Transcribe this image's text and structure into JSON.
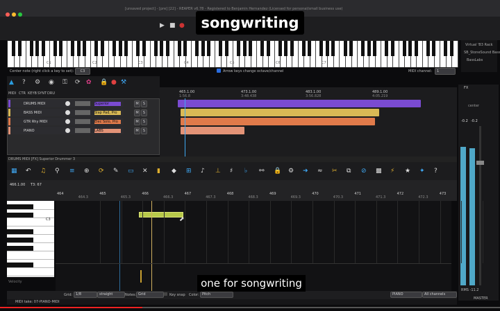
{
  "window": {
    "title": "[unsaved project] - [pre] [22] - REAPER v6.78 - Registered to Benjamin Hernandez (Licensed for personal/small business use)"
  },
  "overlay_title": "songwriting",
  "subtitle": "one for songwriting",
  "keyboard": {
    "octave_labels": [
      "C1",
      "C2",
      "C3",
      "C4",
      "C5",
      "C6",
      "C7"
    ],
    "center_note_label": "Center note (right click a key to set):",
    "center_note_value": "C3",
    "arrow_keys_label": "Arrow keys change octave/channel",
    "midi_channel_label": "MIDI channel:",
    "midi_channel_value": "1"
  },
  "right_panel": {
    "items": [
      "Virtual 'B3 Rack",
      "SB_StoneSound Bass Congas",
      "BassLabs"
    ]
  },
  "toolbar_left": [
    "MIDI",
    "CTR",
    "KEYB",
    "SYNT",
    "DRU"
  ],
  "tracks": [
    {
      "name": "DRUMS MIDI",
      "plugin": "Superior",
      "color": "#7a4bd1"
    },
    {
      "name": "BASS MIDI",
      "plugin": "Slap Pad, Pro",
      "color": "#d9b955"
    },
    {
      "name": "GTR Rhy MIDI",
      "plugin": "Elec Solo, Pro",
      "color": "#e07a4a"
    },
    {
      "name": "PIANO",
      "plugin": "LABS",
      "color": "#e39377"
    }
  ],
  "track_button_m": "M",
  "track_button_s": "S",
  "arrange_ruler": [
    "465.1.00",
    "473.1.00",
    "483.1.00",
    "489.1.00"
  ],
  "arrange_ruler_sub": [
    "1:56.8",
    "3:48.438",
    "3:56.828",
    "4:05.219"
  ],
  "midi_editor": {
    "header": "DRUMS MIDI [FX] Superior Drummer 3",
    "pos_top": "466.1.00",
    "pos_sub": "T3: 67",
    "bars": [
      "464",
      "464.3",
      "465",
      "465.3",
      "466",
      "466.3",
      "467",
      "467.3",
      "468",
      "468.3",
      "469",
      "469.3",
      "470",
      "470.3",
      "471",
      "471.3",
      "472",
      "472.3",
      "473"
    ],
    "key_label": "C3",
    "bottom_label": "Velocity",
    "take_label": "MIDI take: 07-PIANO-MIDI"
  },
  "bottom_bar": {
    "grid_label": "Grid:",
    "grid_value": "1/8",
    "straight": "straight",
    "notes_label": "Notes:",
    "notes_value": "Grid",
    "color_label": "Color:",
    "color_value": "Pitch",
    "key_snap": "Key snap",
    "piano": "PIANO",
    "all_channels": "All channels"
  },
  "mixer": {
    "fx": "FX",
    "levels": [
      "-0.2",
      "-0.2"
    ],
    "rms": "RMS  -11.2",
    "master": "MASTER",
    "center": "center"
  },
  "colors": {
    "accent": "#2a6de0",
    "drums": "#7a4bd1",
    "bass": "#d9b955",
    "gtr": "#e07a4a",
    "piano": "#e39377",
    "note": "#b7c94a",
    "meter": "#4fa8c8"
  }
}
